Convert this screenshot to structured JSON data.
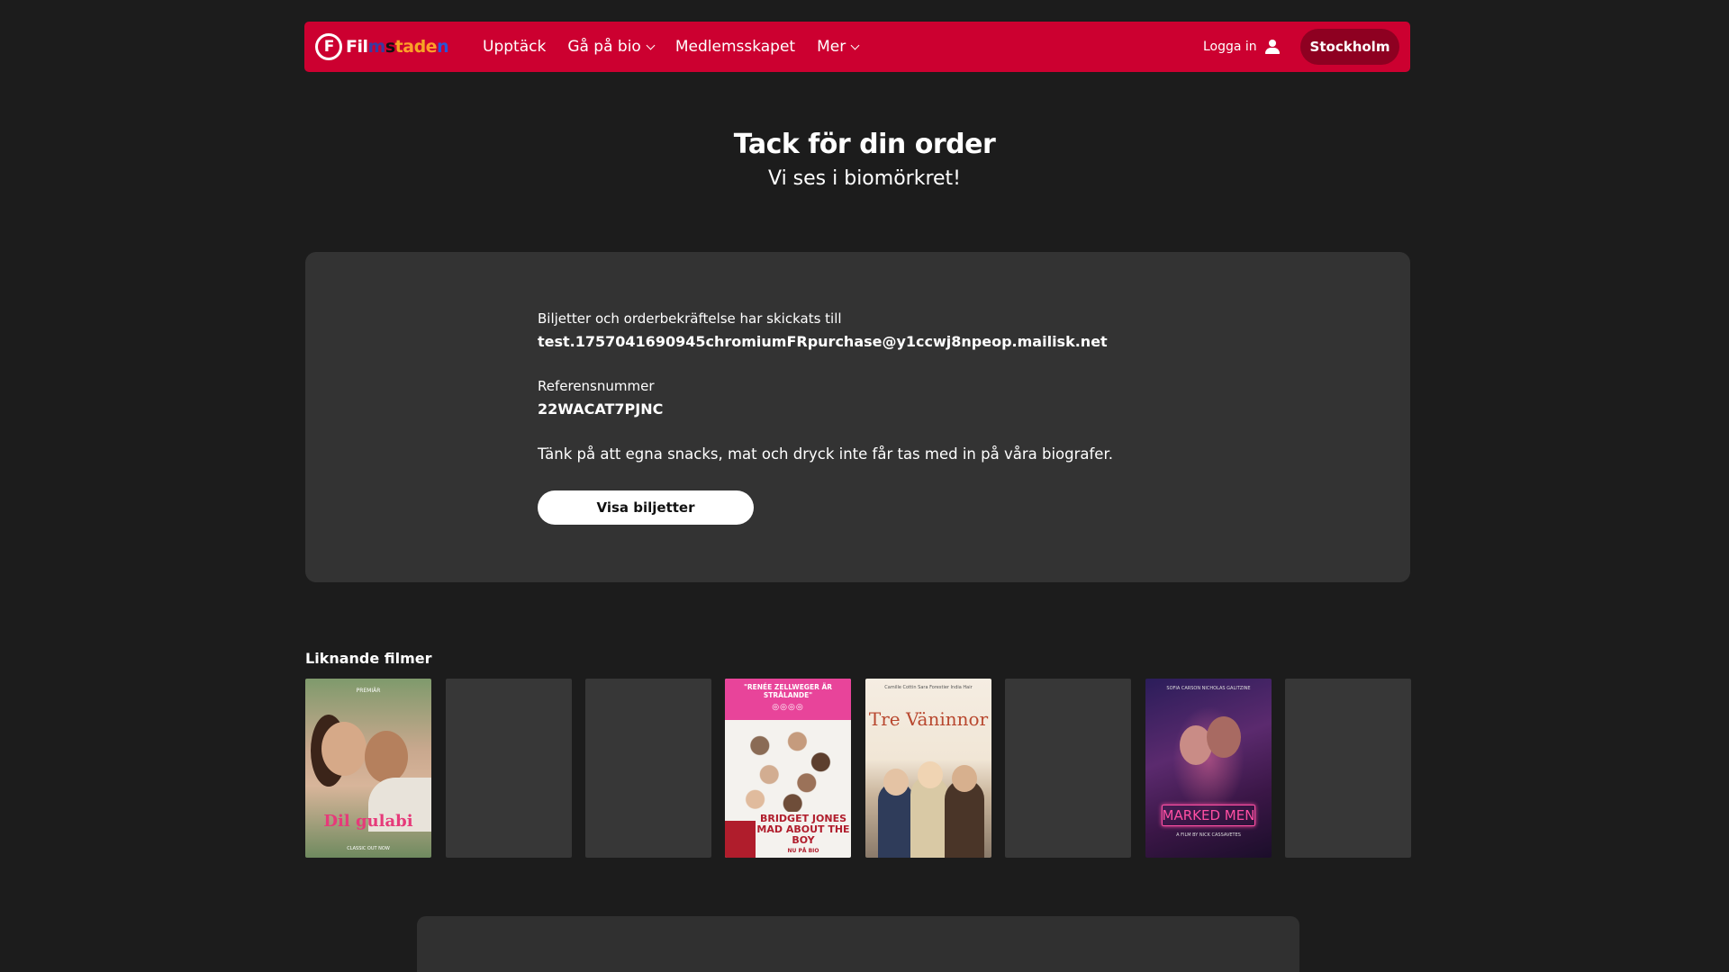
{
  "header": {
    "logo_text": "Filmstaden",
    "logo_icon": "filmstaden-logo-icon",
    "nav": [
      {
        "label": "Upptäck",
        "has_dropdown": false
      },
      {
        "label": "Gå på bio",
        "has_dropdown": true
      },
      {
        "label": "Medlemsskapet",
        "has_dropdown": false
      },
      {
        "label": "Mer",
        "has_dropdown": true
      }
    ],
    "login_label": "Logga in",
    "login_icon": "user-icon",
    "city_button": "Stockholm",
    "brand_color": "#cc0030"
  },
  "hero": {
    "title": "Tack för din order",
    "subtitle": "Vi ses i biomörkret!"
  },
  "confirmation": {
    "sent_label": "Biljetter och orderbekräftelse har skickats till",
    "email": "test.1757041690945chromiumFRpurchase@y1ccwj8npeop.mailisk.net",
    "reference_label": "Referensnummer",
    "reference_number": "22WACAT7PJNC",
    "note": "Tänk på att egna snacks, mat och dryck inte får tas med in på våra biografer.",
    "button": "Visa biljetter"
  },
  "similar": {
    "title": "Liknande filmer",
    "posters": [
      {
        "loaded": true,
        "title": "Dil gulabi",
        "top_text": "PREMIÄR",
        "bottom_text": "CLASSIC OUT NOW"
      },
      {
        "loaded": false
      },
      {
        "loaded": false
      },
      {
        "loaded": true,
        "quote": "\"RENÉE ZELLWEGER ÄR STRÅLANDE\"",
        "stars": "◎◎◎◎",
        "title": "BRIDGET JONES MAD ABOUT THE BOY",
        "bottom_text": "NU PÅ BIO"
      },
      {
        "loaded": true,
        "title": "Tre Väninnor",
        "top_text": "Camille Cottin   Sara Forestier   India Hair"
      },
      {
        "loaded": false
      },
      {
        "loaded": true,
        "title": "MARKED MEN",
        "top_text": "SOFIA CARSON   NICHOLAS GALITZINE",
        "bottom_text": "A FILM BY NICK CASSAVETES"
      },
      {
        "loaded": false
      }
    ]
  }
}
